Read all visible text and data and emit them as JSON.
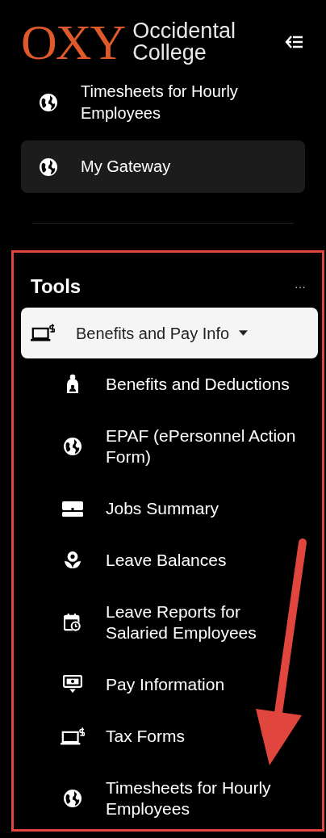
{
  "header": {
    "logo_mark": "OXY",
    "logo_text": [
      "Occidental",
      "College"
    ]
  },
  "top_items": [
    {
      "label": "Timesheets for Hourly Employees",
      "kind": "globe",
      "selected": false
    },
    {
      "label": "My Gateway",
      "kind": "globe",
      "selected": true
    }
  ],
  "tools": {
    "title": "Tools",
    "more": "···",
    "group": {
      "label": "Benefits and Pay Info",
      "kind": "laptop-dollar",
      "expanded": true,
      "children": [
        {
          "label": "Benefits and Deductions",
          "kind": "person"
        },
        {
          "label": "EPAF (ePersonnel Action Form)",
          "kind": "globe"
        },
        {
          "label": "Jobs Summary",
          "kind": "briefcase"
        },
        {
          "label": "Leave Balances",
          "kind": "flower"
        },
        {
          "label": "Leave Reports for Salaried Employees",
          "kind": "calendar-clock"
        },
        {
          "label": "Pay Information",
          "kind": "money"
        },
        {
          "label": "Tax Forms",
          "kind": "laptop-dollar"
        },
        {
          "label": "Timesheets for Hourly Employees",
          "kind": "globe"
        }
      ]
    }
  },
  "annotation": {
    "highlight_box": true,
    "arrow": true
  }
}
